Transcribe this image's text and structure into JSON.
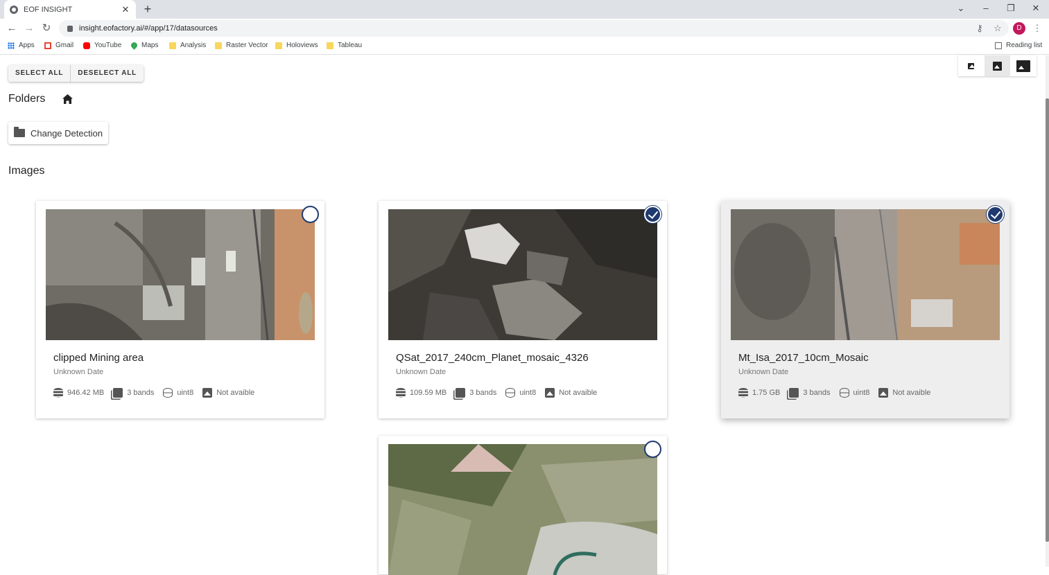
{
  "browser": {
    "tab_title": "EOF INSIGHT",
    "url": "insight.eofactory.ai/#/app/17/datasources",
    "profile_initial": "D",
    "bookmarks": [
      {
        "label": "Apps",
        "icon": "apps-icon"
      },
      {
        "label": "Gmail",
        "icon": "gmail-icon"
      },
      {
        "label": "YouTube",
        "icon": "youtube-icon"
      },
      {
        "label": "Maps",
        "icon": "maps-icon"
      },
      {
        "label": "Analysis",
        "icon": "folder-icon"
      },
      {
        "label": "Raster Vector",
        "icon": "folder-icon"
      },
      {
        "label": "Holoviews",
        "icon": "folder-icon"
      },
      {
        "label": "Tableau",
        "icon": "folder-icon"
      }
    ],
    "reading_list": "Reading list"
  },
  "toolbar": {
    "select_all": "SELECT ALL",
    "deselect_all": "DESELECT ALL"
  },
  "folders": {
    "heading": "Folders",
    "items": [
      {
        "label": "Change Detection"
      }
    ]
  },
  "images": {
    "heading": "Images",
    "cards": [
      {
        "title": "clipped Mining area",
        "date": "Unknown Date",
        "size": "946.42 MB",
        "bands": "3 bands",
        "dtype": "uint8",
        "preview": "Not avaible",
        "selected": false
      },
      {
        "title": "QSat_2017_240cm_Planet_mosaic_4326",
        "date": "Unknown Date",
        "size": "109.59 MB",
        "bands": "3 bands",
        "dtype": "uint8",
        "preview": "Not avaible",
        "selected": true
      },
      {
        "title": "Mt_Isa_2017_10cm_Mosaic",
        "date": "Unknown Date",
        "size": "1.75 GB",
        "bands": "3 bands",
        "dtype": "uint8",
        "preview": "Not avaible",
        "selected": true
      },
      {
        "title": "",
        "date": "",
        "size": "",
        "bands": "",
        "dtype": "",
        "preview": "",
        "selected": false
      }
    ]
  },
  "colors": {
    "accent": "#1f3a6e",
    "tabbar": "#dee1e6"
  }
}
